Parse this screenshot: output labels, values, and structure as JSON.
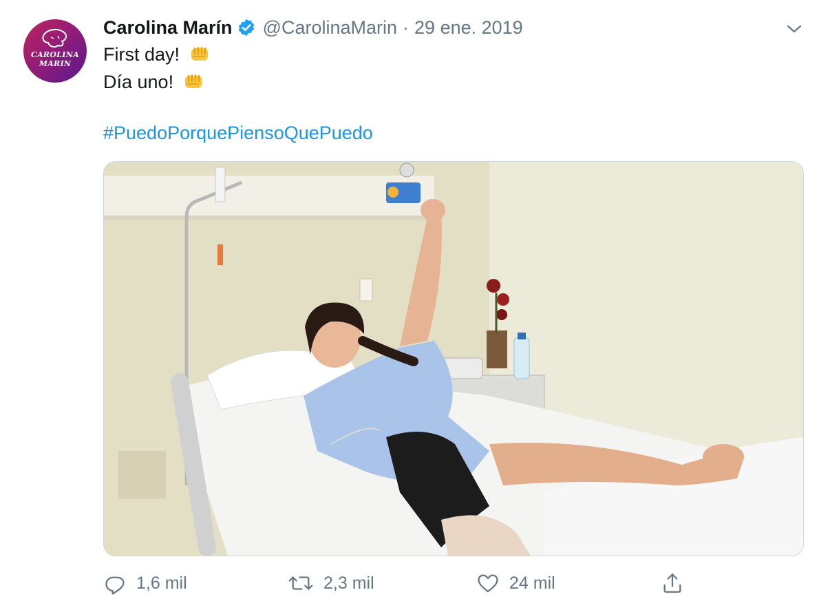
{
  "tweet": {
    "author_name": "Carolina Marín",
    "author_handle": "@CarolinaMarin",
    "separator": "·",
    "date": "29 ene. 2019",
    "avatar_text_line1": "CAROLINA",
    "avatar_text_line2": "MARIN",
    "text_line1": "First day!",
    "text_line2": "Día uno!",
    "hashtag": "#PuedoPorquePiensoQuePuedo",
    "media_icon": "photo",
    "actions": {
      "reply_count": "1,6 mil",
      "retweet_count": "2,3 mil",
      "like_count": "24 mil"
    }
  },
  "icons": {
    "verified": "verified-badge-icon",
    "caret": "chevron-down-icon",
    "emoji": "oncoming-fist-icon",
    "reply": "reply-icon",
    "retweet": "retweet-icon",
    "like": "heart-icon",
    "share": "share-icon"
  },
  "colors": {
    "text": "#14171a",
    "secondary": "#657786",
    "link": "#1b95e0",
    "verified": "#1da1f2",
    "border": "#ccd6dd"
  }
}
